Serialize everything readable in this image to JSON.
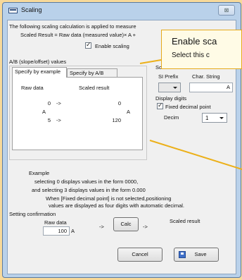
{
  "window": {
    "title": "Scaling",
    "close_label": "⊠"
  },
  "intro": {
    "line1": "The following scaling calculation is applied to measure",
    "formula": "Scaled Result = Raw data (measured value)× A +"
  },
  "enable_scaling": {
    "label": "Enable scaling",
    "checked": true
  },
  "ab_values": {
    "group_label": "A/B (slope/offset) values",
    "tabs": [
      "Specify by example",
      "Specify by A/B"
    ],
    "col_raw": "Raw data",
    "col_scaled": "Scaled result",
    "rows": [
      {
        "raw": "0",
        "scaled": "0"
      },
      {
        "raw": "5",
        "scaled": "120"
      }
    ],
    "unit_raw": "A",
    "unit_scaled": "A",
    "arrow": "->"
  },
  "scaled_units": {
    "group_label": "Scaled units",
    "si_prefix_label": "SI Prefix",
    "si_prefix_value": "",
    "char_string_label": "Char. String",
    "char_string_value": "A"
  },
  "display_digits": {
    "label": "Display digits",
    "fixed_decimal_label": "Fixed decimal point",
    "fixed_decimal_checked": true,
    "decimal_label": "Decim",
    "decimal_value": "1"
  },
  "example": {
    "heading": "Example",
    "line1": "selecting 0 displays values in the form 0000,",
    "line2": "and selecting 3 displays values in the form 0.000",
    "line3": "When [Fixed decimal point] is not selected,positioning",
    "line4": "values are displayed as four digits with automatic decimal."
  },
  "confirmation": {
    "group_label": "Setting confirmation",
    "raw_label": "Raw data",
    "raw_value": "100",
    "raw_unit": "A",
    "arrow": "->",
    "calc_label": "Calc",
    "scaled_label": "Scaled result"
  },
  "buttons": {
    "cancel": "Cancel",
    "save": "Save"
  },
  "tooltip": {
    "title": "Enable sca",
    "description": "Select this c"
  },
  "colors": {
    "background": "#f7d99a",
    "tooltip_border": "#e6a91a",
    "callout_line": "#ecb019",
    "titlebar": "#b9d1ea"
  }
}
